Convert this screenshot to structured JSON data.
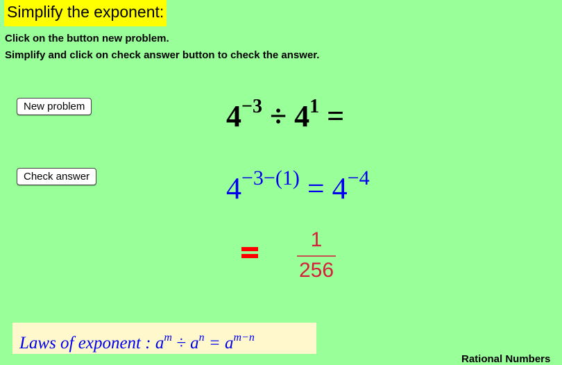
{
  "header": {
    "title": "Simplify the exponent:",
    "instruction_1": "Click on the button new problem.",
    "instruction_2": "Simplify and click on check answer button to check the answer."
  },
  "buttons": {
    "new_problem": "New problem",
    "check_answer": "Check answer"
  },
  "problem": {
    "base": "4",
    "exp1": "−3",
    "operator": "÷",
    "exp2": "1",
    "equals": "="
  },
  "solution": {
    "base": "4",
    "combined_exponent": "−3−(1)",
    "equals": "=",
    "result_base": "4",
    "result_exponent": "−4"
  },
  "answer": {
    "numerator": "1",
    "denominator": "256"
  },
  "law": {
    "label": "Laws of exponent : a",
    "m": "m",
    "div": " ÷ a",
    "n": "n",
    "eq": " = a",
    "mn": "m−n"
  },
  "footer": {
    "text": "Rational Numbers"
  },
  "colors": {
    "background": "#99ff99",
    "title_highlight": "#ffff00",
    "solution_blue": "#0000ee",
    "answer_red": "#d4203c",
    "law_background": "#fff8cc"
  }
}
